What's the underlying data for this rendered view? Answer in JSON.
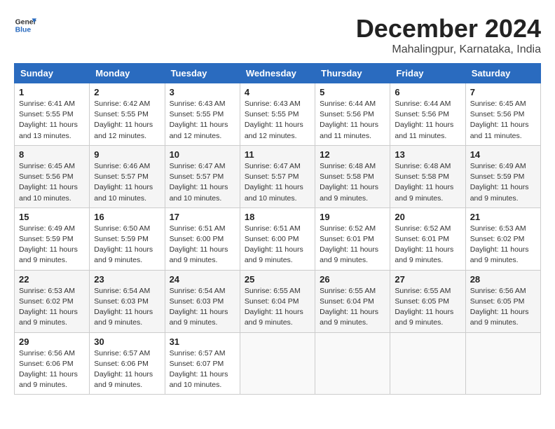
{
  "logo": {
    "line1": "General",
    "line2": "Blue"
  },
  "title": "December 2024",
  "subtitle": "Mahalingpur, Karnataka, India",
  "weekdays": [
    "Sunday",
    "Monday",
    "Tuesday",
    "Wednesday",
    "Thursday",
    "Friday",
    "Saturday"
  ],
  "weeks": [
    [
      {
        "day": "1",
        "info": "Sunrise: 6:41 AM\nSunset: 5:55 PM\nDaylight: 11 hours and 13 minutes."
      },
      {
        "day": "2",
        "info": "Sunrise: 6:42 AM\nSunset: 5:55 PM\nDaylight: 11 hours and 12 minutes."
      },
      {
        "day": "3",
        "info": "Sunrise: 6:43 AM\nSunset: 5:55 PM\nDaylight: 11 hours and 12 minutes."
      },
      {
        "day": "4",
        "info": "Sunrise: 6:43 AM\nSunset: 5:55 PM\nDaylight: 11 hours and 12 minutes."
      },
      {
        "day": "5",
        "info": "Sunrise: 6:44 AM\nSunset: 5:56 PM\nDaylight: 11 hours and 11 minutes."
      },
      {
        "day": "6",
        "info": "Sunrise: 6:44 AM\nSunset: 5:56 PM\nDaylight: 11 hours and 11 minutes."
      },
      {
        "day": "7",
        "info": "Sunrise: 6:45 AM\nSunset: 5:56 PM\nDaylight: 11 hours and 11 minutes."
      }
    ],
    [
      {
        "day": "8",
        "info": "Sunrise: 6:45 AM\nSunset: 5:56 PM\nDaylight: 11 hours and 10 minutes."
      },
      {
        "day": "9",
        "info": "Sunrise: 6:46 AM\nSunset: 5:57 PM\nDaylight: 11 hours and 10 minutes."
      },
      {
        "day": "10",
        "info": "Sunrise: 6:47 AM\nSunset: 5:57 PM\nDaylight: 11 hours and 10 minutes."
      },
      {
        "day": "11",
        "info": "Sunrise: 6:47 AM\nSunset: 5:57 PM\nDaylight: 11 hours and 10 minutes."
      },
      {
        "day": "12",
        "info": "Sunrise: 6:48 AM\nSunset: 5:58 PM\nDaylight: 11 hours and 9 minutes."
      },
      {
        "day": "13",
        "info": "Sunrise: 6:48 AM\nSunset: 5:58 PM\nDaylight: 11 hours and 9 minutes."
      },
      {
        "day": "14",
        "info": "Sunrise: 6:49 AM\nSunset: 5:59 PM\nDaylight: 11 hours and 9 minutes."
      }
    ],
    [
      {
        "day": "15",
        "info": "Sunrise: 6:49 AM\nSunset: 5:59 PM\nDaylight: 11 hours and 9 minutes."
      },
      {
        "day": "16",
        "info": "Sunrise: 6:50 AM\nSunset: 5:59 PM\nDaylight: 11 hours and 9 minutes."
      },
      {
        "day": "17",
        "info": "Sunrise: 6:51 AM\nSunset: 6:00 PM\nDaylight: 11 hours and 9 minutes."
      },
      {
        "day": "18",
        "info": "Sunrise: 6:51 AM\nSunset: 6:00 PM\nDaylight: 11 hours and 9 minutes."
      },
      {
        "day": "19",
        "info": "Sunrise: 6:52 AM\nSunset: 6:01 PM\nDaylight: 11 hours and 9 minutes."
      },
      {
        "day": "20",
        "info": "Sunrise: 6:52 AM\nSunset: 6:01 PM\nDaylight: 11 hours and 9 minutes."
      },
      {
        "day": "21",
        "info": "Sunrise: 6:53 AM\nSunset: 6:02 PM\nDaylight: 11 hours and 9 minutes."
      }
    ],
    [
      {
        "day": "22",
        "info": "Sunrise: 6:53 AM\nSunset: 6:02 PM\nDaylight: 11 hours and 9 minutes."
      },
      {
        "day": "23",
        "info": "Sunrise: 6:54 AM\nSunset: 6:03 PM\nDaylight: 11 hours and 9 minutes."
      },
      {
        "day": "24",
        "info": "Sunrise: 6:54 AM\nSunset: 6:03 PM\nDaylight: 11 hours and 9 minutes."
      },
      {
        "day": "25",
        "info": "Sunrise: 6:55 AM\nSunset: 6:04 PM\nDaylight: 11 hours and 9 minutes."
      },
      {
        "day": "26",
        "info": "Sunrise: 6:55 AM\nSunset: 6:04 PM\nDaylight: 11 hours and 9 minutes."
      },
      {
        "day": "27",
        "info": "Sunrise: 6:55 AM\nSunset: 6:05 PM\nDaylight: 11 hours and 9 minutes."
      },
      {
        "day": "28",
        "info": "Sunrise: 6:56 AM\nSunset: 6:05 PM\nDaylight: 11 hours and 9 minutes."
      }
    ],
    [
      {
        "day": "29",
        "info": "Sunrise: 6:56 AM\nSunset: 6:06 PM\nDaylight: 11 hours and 9 minutes."
      },
      {
        "day": "30",
        "info": "Sunrise: 6:57 AM\nSunset: 6:06 PM\nDaylight: 11 hours and 9 minutes."
      },
      {
        "day": "31",
        "info": "Sunrise: 6:57 AM\nSunset: 6:07 PM\nDaylight: 11 hours and 10 minutes."
      },
      null,
      null,
      null,
      null
    ]
  ]
}
